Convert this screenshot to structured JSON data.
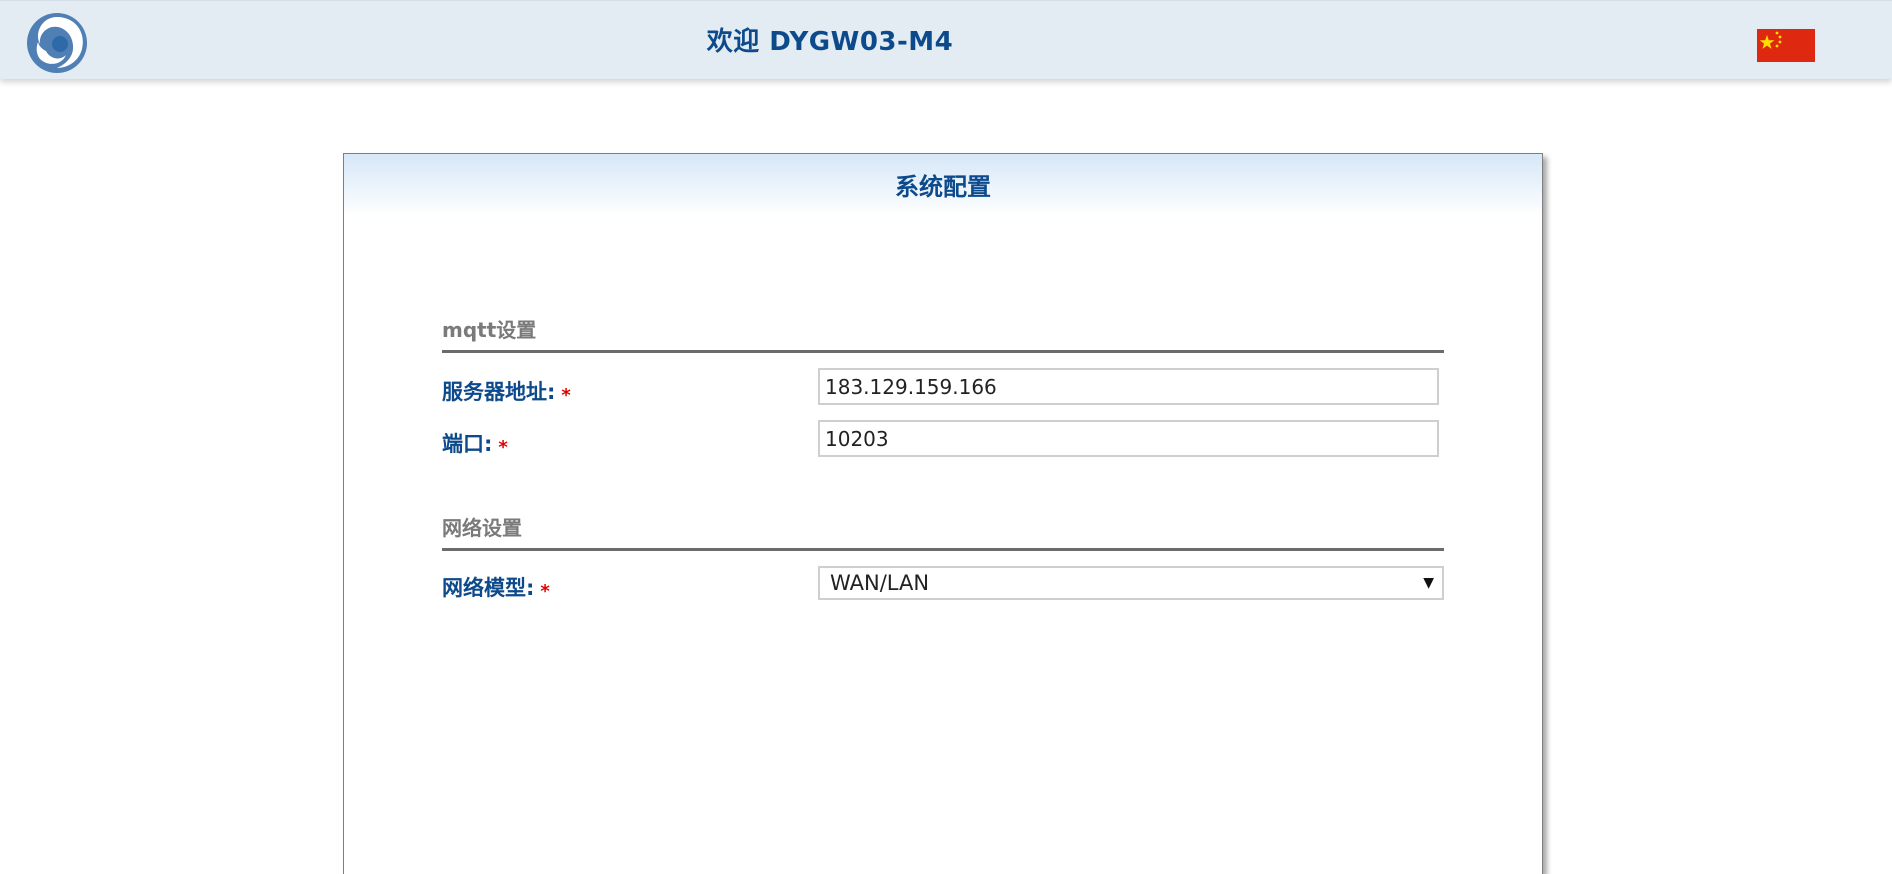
{
  "header": {
    "title": "欢迎 DYGW03-M4",
    "logo_icon": "swirl-logo-icon",
    "language_flag_icon": "china-flag-icon"
  },
  "panel": {
    "title": "系统配置",
    "mqtt": {
      "section_title": "mqtt设置",
      "server_label": "服务器地址:",
      "server_value": "183.129.159.166",
      "port_label": "端口:",
      "port_value": "10203"
    },
    "network": {
      "section_title": "网络设置",
      "mode_label": "网络模型:",
      "mode_value": "WAN/LAN"
    },
    "required_mark": "*"
  },
  "colors": {
    "brand_blue": "#0d4a8c",
    "header_bg": "#e3ebf3",
    "required_red": "#e00000"
  }
}
